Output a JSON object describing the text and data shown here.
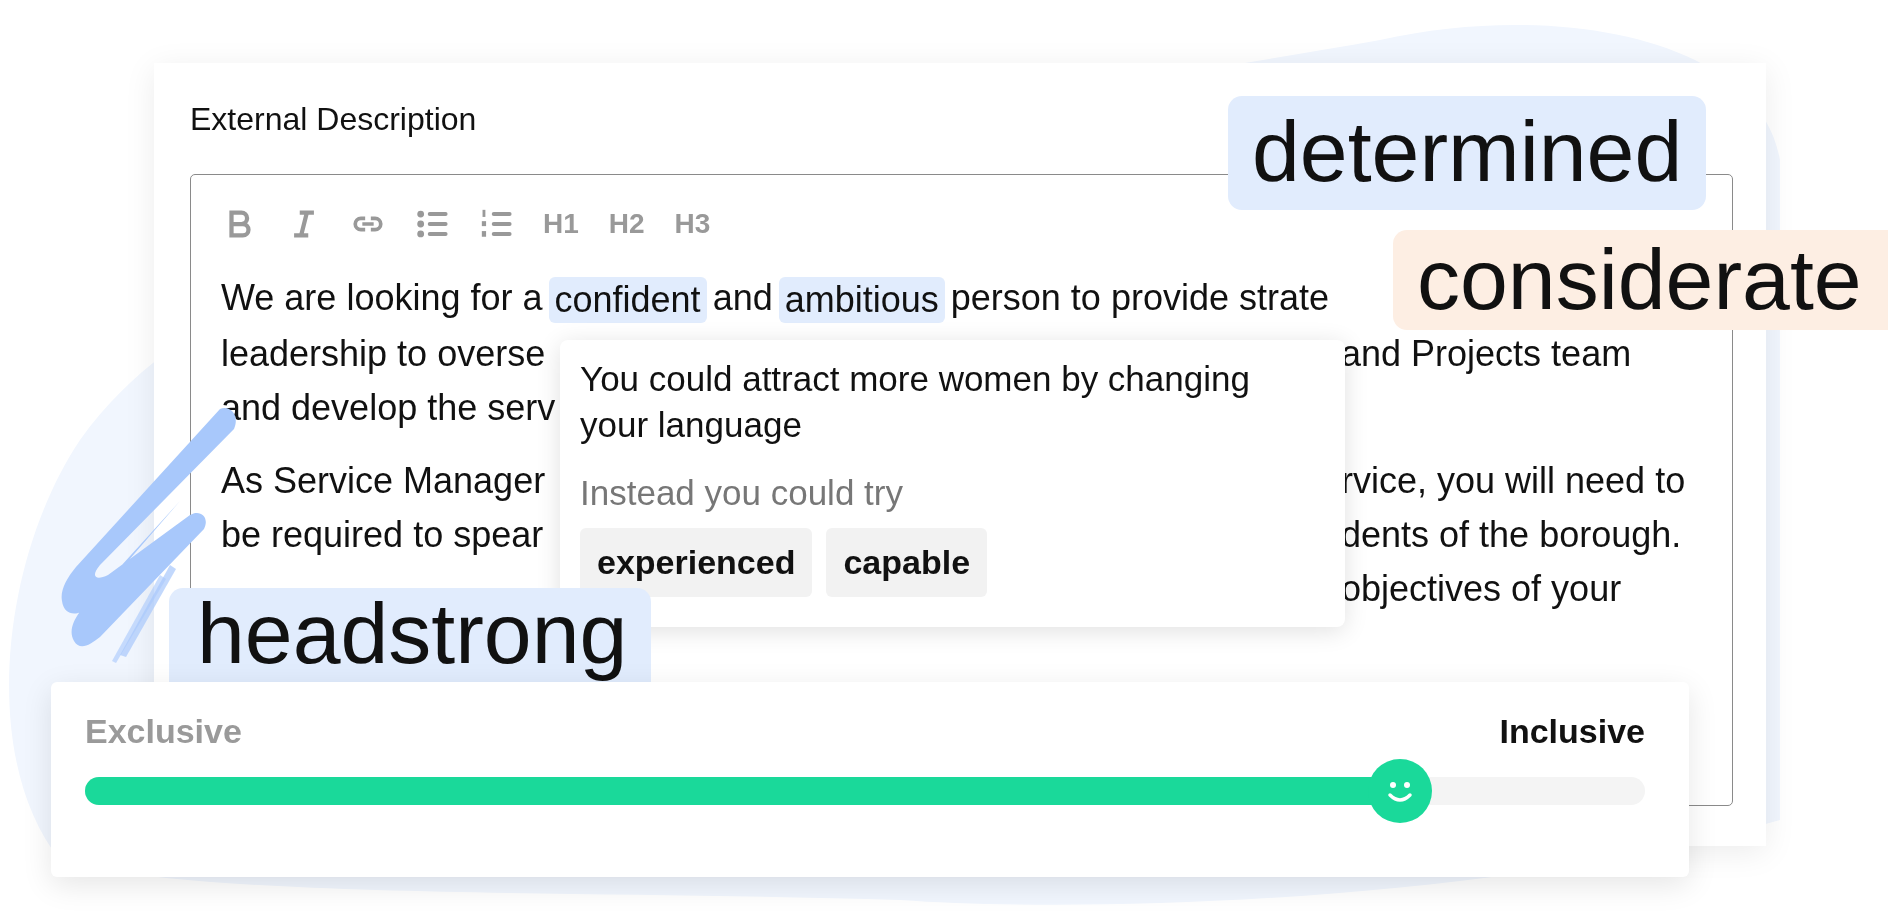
{
  "card": {
    "title": "External Description"
  },
  "toolbar": [
    {
      "kind": "bold"
    },
    {
      "kind": "italic"
    },
    {
      "kind": "link"
    },
    {
      "kind": "bullet_list"
    },
    {
      "kind": "numbered_list"
    },
    {
      "kind": "heading",
      "label": "H1"
    },
    {
      "kind": "heading",
      "label": "H2"
    },
    {
      "kind": "heading",
      "label": "H3"
    }
  ],
  "paragraphs": [
    {
      "lines": [
        {
          "left": [
            {
              "text": "We are looking for a",
              "highlighted": false
            },
            {
              "text": "confident",
              "highlighted": true
            },
            {
              "text": "and",
              "highlighted": false
            },
            {
              "text": "ambitious",
              "highlighted": true
            },
            {
              "text": "person to provide strate",
              "highlighted": false
            }
          ]
        },
        {
          "left": [
            {
              "text": "leadership to overse",
              "highlighted": false
            }
          ],
          "right": [
            {
              "text": "and Projects team",
              "highlighted": false
            }
          ]
        },
        {
          "left": [
            {
              "text": "and develop the serv",
              "highlighted": false
            }
          ]
        }
      ]
    },
    {
      "lines": [
        {
          "left": [
            {
              "text": "As Service Manager",
              "highlighted": false
            }
          ],
          "right": [
            {
              "text": "rvice, you will need to",
              "highlighted": false
            }
          ]
        },
        {
          "left": [
            {
              "text": "be required to spear",
              "highlighted": false
            }
          ],
          "right": [
            {
              "text": "dents of the borough.",
              "highlighted": false
            }
          ]
        },
        {
          "right": [
            {
              "text": "objectives of your",
              "highlighted": false
            }
          ]
        }
      ]
    }
  ],
  "popover": {
    "message": "You could attract more women by changing your language",
    "hint": "Instead you could try",
    "suggestions": [
      "experienced",
      "capable"
    ]
  },
  "tags": [
    {
      "text": "determined",
      "color": "#e1ecfd"
    },
    {
      "text": "considerate",
      "color": "#fdeee3"
    },
    {
      "text": "headstrong",
      "color": "#e1ecfd"
    }
  ],
  "slider": {
    "left_label": "Exclusive",
    "right_label": "Inclusive",
    "level": 0.843
  }
}
